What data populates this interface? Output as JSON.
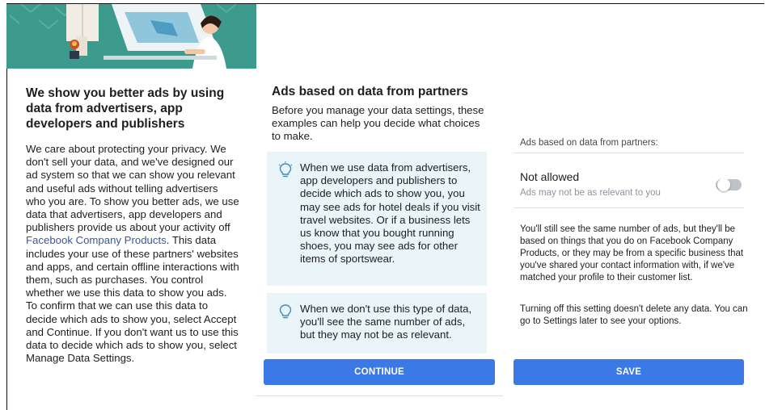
{
  "left": {
    "title": "We show you better ads by using data from advertisers, app developers and publishers",
    "body_before_link": "We care about protecting your privacy. We don't sell your data, and we've designed our ad system so that we can show you relevant and useful ads without telling advertisers who you are. To show you better ads, we use data that advertisers, app developers and publishers provide us about your activity off ",
    "link_text": "Facebook Company Products",
    "body_after_link": ". This data includes your use of these partners' websites and apps, and certain offline interactions with them, such as purchases. You control whether we use this data to show you ads. To confirm that we can use this data to decide which ads to show you, select Accept and Continue. If you don't want us to use this data to decide which ads to show you, select Manage Data Settings."
  },
  "middle": {
    "title": "Ads based on data from partners",
    "intro": "Before you manage your data settings, these examples can help you decide what choices to make.",
    "cards": [
      {
        "text": "When we use data from advertisers, app developers and publishers to decide which ads to show you, you may see ads for hotel deals if you visit travel websites. Or if a business lets us know that you bought running shoes, you may see ads for other items of sportswear.",
        "icon": "lightbulb-icon"
      },
      {
        "text": "When we don't use this type of data, you'll see the same number of ads, but they may not be as relevant.",
        "icon": "lightbulb-icon"
      }
    ],
    "continue_label": "CONTINUE"
  },
  "right": {
    "section_label": "Ads based on data from partners:",
    "setting_title": "Not allowed",
    "setting_subtitle": "Ads may not be as relevant to you",
    "toggle_on": false,
    "paragraph1": "You'll still see the same number of ads, but they'll be based on things that you do on Facebook Company Products, or they may be from a specific business that you've shared your contact information with, if we've matched your profile to their customer list.",
    "paragraph2": "Turning off this setting doesn't delete any data. You can go to Settings later to see your options.",
    "save_label": "SAVE"
  },
  "colors": {
    "button": "#3b79e6",
    "card_background": "#e9f5f9",
    "illustration_teal": "#3d9b8d",
    "link": "#385898"
  }
}
